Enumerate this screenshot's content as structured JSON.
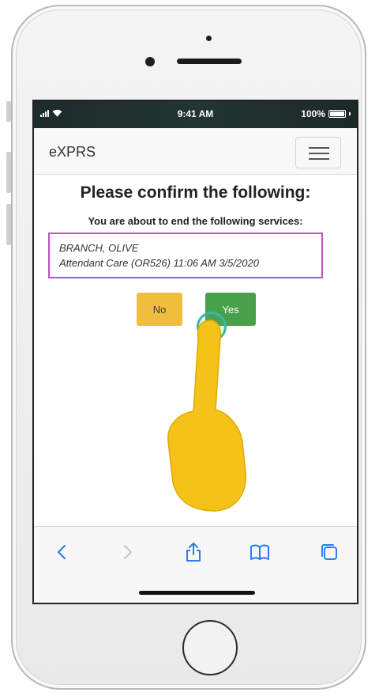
{
  "status_bar": {
    "time": "9:41 AM",
    "battery": "100%"
  },
  "navbar": {
    "brand": "eXPRS",
    "menu_icon": "hamburger-menu-icon"
  },
  "dialog": {
    "heading": "Please confirm the following:",
    "subheading": "You are about to end the following services:",
    "service": {
      "client_name": "BRANCH, OLIVE",
      "detail": "Attendant Care (OR526) 11:06 AM 3/5/2020"
    },
    "no_label": "No",
    "yes_label": "Yes"
  },
  "browser_toolbar": {
    "items": [
      "back-icon",
      "forward-icon",
      "share-icon",
      "bookmarks-icon",
      "tabs-icon"
    ]
  },
  "colors": {
    "no_button": "#f0be3a",
    "yes_button": "#49a04a",
    "highlight_border": "#c44fc9",
    "tap_ring": "#3eb5a6",
    "pointer_hand": "#f5c21a",
    "toolbar_icon": "#2f7bf5"
  }
}
